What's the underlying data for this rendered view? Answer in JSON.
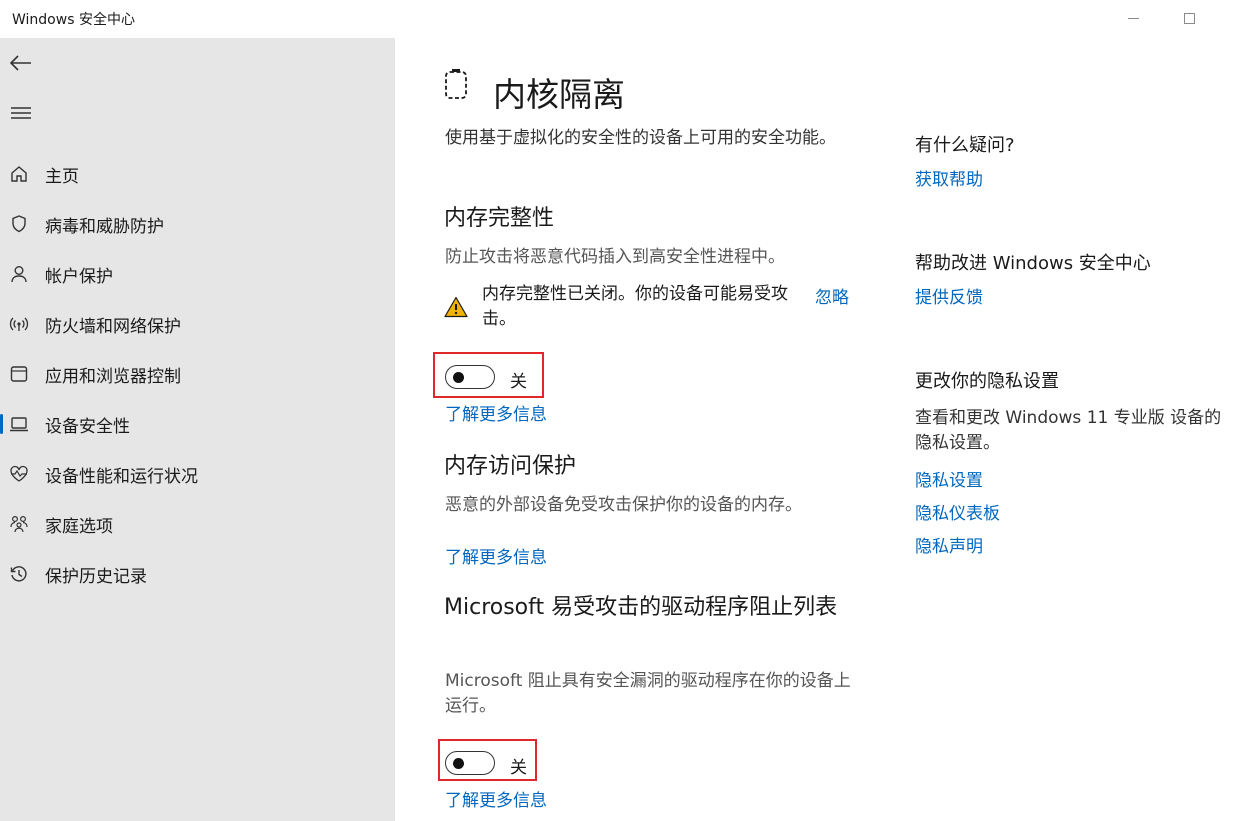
{
  "titlebar": {
    "title": "Windows 安全中心"
  },
  "sidebar": {
    "items": [
      {
        "label": "主页"
      },
      {
        "label": "病毒和威胁防护"
      },
      {
        "label": "帐户保护"
      },
      {
        "label": "防火墙和网络保护"
      },
      {
        "label": "应用和浏览器控制"
      },
      {
        "label": "设备安全性",
        "active": true
      },
      {
        "label": "设备性能和运行状况"
      },
      {
        "label": "家庭选项"
      },
      {
        "label": "保护历史记录"
      }
    ]
  },
  "main": {
    "title": "内核隔离",
    "intro": "使用基于虚拟化的安全性的设备上可用的安全功能。",
    "memory_integrity": {
      "heading": "内存完整性",
      "description": "防止攻击将恶意代码插入到高安全性进程中。",
      "warning": "内存完整性已关闭。你的设备可能易受攻击。",
      "dismiss": "忽略",
      "toggle_state": "关",
      "learn_more": "了解更多信息"
    },
    "memory_access": {
      "heading": "内存访问保护",
      "description": "恶意的外部设备免受攻击保护你的设备的内存。",
      "learn_more": "了解更多信息"
    },
    "driver_blocklist": {
      "heading": "Microsoft 易受攻击的驱动程序阻止列表",
      "description": "Microsoft 阻止具有安全漏洞的驱动程序在你的设备上运行。",
      "toggle_state": "关",
      "learn_more": "了解更多信息"
    }
  },
  "aside": {
    "question": {
      "heading": "有什么疑问?",
      "link": "获取帮助"
    },
    "improve": {
      "heading": "帮助改进 Windows 安全中心",
      "link": "提供反馈"
    },
    "privacy": {
      "heading": "更改你的隐私设置",
      "description": "查看和更改 Windows 11 专业版 设备的隐私设置。",
      "links": [
        "隐私设置",
        "隐私仪表板",
        "隐私声明"
      ]
    }
  },
  "colors": {
    "accent": "#0067c0",
    "highlight": "#e0282a",
    "warning": "#f0b400",
    "sidebar": "#e6e6e6"
  }
}
